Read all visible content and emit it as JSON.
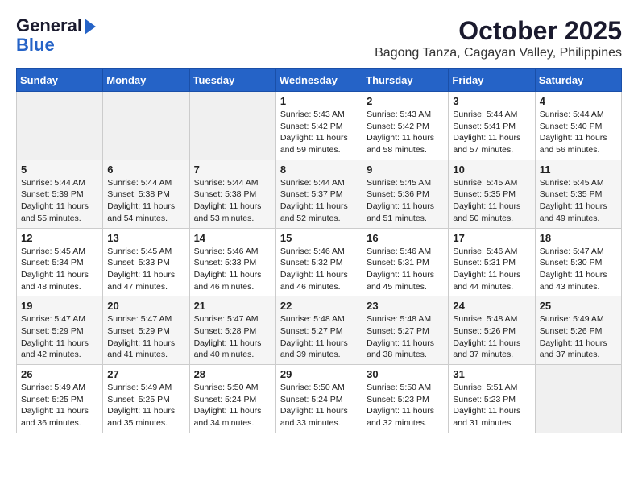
{
  "logo": {
    "line1": "General",
    "line2": "Blue"
  },
  "title": "October 2025",
  "subtitle": "Bagong Tanza, Cagayan Valley, Philippines",
  "days_of_week": [
    "Sunday",
    "Monday",
    "Tuesday",
    "Wednesday",
    "Thursday",
    "Friday",
    "Saturday"
  ],
  "weeks": [
    [
      {
        "day": "",
        "sunrise": "",
        "sunset": "",
        "daylight": ""
      },
      {
        "day": "",
        "sunrise": "",
        "sunset": "",
        "daylight": ""
      },
      {
        "day": "",
        "sunrise": "",
        "sunset": "",
        "daylight": ""
      },
      {
        "day": "1",
        "sunrise": "Sunrise: 5:43 AM",
        "sunset": "Sunset: 5:42 PM",
        "daylight": "Daylight: 11 hours and 59 minutes."
      },
      {
        "day": "2",
        "sunrise": "Sunrise: 5:43 AM",
        "sunset": "Sunset: 5:42 PM",
        "daylight": "Daylight: 11 hours and 58 minutes."
      },
      {
        "day": "3",
        "sunrise": "Sunrise: 5:44 AM",
        "sunset": "Sunset: 5:41 PM",
        "daylight": "Daylight: 11 hours and 57 minutes."
      },
      {
        "day": "4",
        "sunrise": "Sunrise: 5:44 AM",
        "sunset": "Sunset: 5:40 PM",
        "daylight": "Daylight: 11 hours and 56 minutes."
      }
    ],
    [
      {
        "day": "5",
        "sunrise": "Sunrise: 5:44 AM",
        "sunset": "Sunset: 5:39 PM",
        "daylight": "Daylight: 11 hours and 55 minutes."
      },
      {
        "day": "6",
        "sunrise": "Sunrise: 5:44 AM",
        "sunset": "Sunset: 5:38 PM",
        "daylight": "Daylight: 11 hours and 54 minutes."
      },
      {
        "day": "7",
        "sunrise": "Sunrise: 5:44 AM",
        "sunset": "Sunset: 5:38 PM",
        "daylight": "Daylight: 11 hours and 53 minutes."
      },
      {
        "day": "8",
        "sunrise": "Sunrise: 5:44 AM",
        "sunset": "Sunset: 5:37 PM",
        "daylight": "Daylight: 11 hours and 52 minutes."
      },
      {
        "day": "9",
        "sunrise": "Sunrise: 5:45 AM",
        "sunset": "Sunset: 5:36 PM",
        "daylight": "Daylight: 11 hours and 51 minutes."
      },
      {
        "day": "10",
        "sunrise": "Sunrise: 5:45 AM",
        "sunset": "Sunset: 5:35 PM",
        "daylight": "Daylight: 11 hours and 50 minutes."
      },
      {
        "day": "11",
        "sunrise": "Sunrise: 5:45 AM",
        "sunset": "Sunset: 5:35 PM",
        "daylight": "Daylight: 11 hours and 49 minutes."
      }
    ],
    [
      {
        "day": "12",
        "sunrise": "Sunrise: 5:45 AM",
        "sunset": "Sunset: 5:34 PM",
        "daylight": "Daylight: 11 hours and 48 minutes."
      },
      {
        "day": "13",
        "sunrise": "Sunrise: 5:45 AM",
        "sunset": "Sunset: 5:33 PM",
        "daylight": "Daylight: 11 hours and 47 minutes."
      },
      {
        "day": "14",
        "sunrise": "Sunrise: 5:46 AM",
        "sunset": "Sunset: 5:33 PM",
        "daylight": "Daylight: 11 hours and 46 minutes."
      },
      {
        "day": "15",
        "sunrise": "Sunrise: 5:46 AM",
        "sunset": "Sunset: 5:32 PM",
        "daylight": "Daylight: 11 hours and 46 minutes."
      },
      {
        "day": "16",
        "sunrise": "Sunrise: 5:46 AM",
        "sunset": "Sunset: 5:31 PM",
        "daylight": "Daylight: 11 hours and 45 minutes."
      },
      {
        "day": "17",
        "sunrise": "Sunrise: 5:46 AM",
        "sunset": "Sunset: 5:31 PM",
        "daylight": "Daylight: 11 hours and 44 minutes."
      },
      {
        "day": "18",
        "sunrise": "Sunrise: 5:47 AM",
        "sunset": "Sunset: 5:30 PM",
        "daylight": "Daylight: 11 hours and 43 minutes."
      }
    ],
    [
      {
        "day": "19",
        "sunrise": "Sunrise: 5:47 AM",
        "sunset": "Sunset: 5:29 PM",
        "daylight": "Daylight: 11 hours and 42 minutes."
      },
      {
        "day": "20",
        "sunrise": "Sunrise: 5:47 AM",
        "sunset": "Sunset: 5:29 PM",
        "daylight": "Daylight: 11 hours and 41 minutes."
      },
      {
        "day": "21",
        "sunrise": "Sunrise: 5:47 AM",
        "sunset": "Sunset: 5:28 PM",
        "daylight": "Daylight: 11 hours and 40 minutes."
      },
      {
        "day": "22",
        "sunrise": "Sunrise: 5:48 AM",
        "sunset": "Sunset: 5:27 PM",
        "daylight": "Daylight: 11 hours and 39 minutes."
      },
      {
        "day": "23",
        "sunrise": "Sunrise: 5:48 AM",
        "sunset": "Sunset: 5:27 PM",
        "daylight": "Daylight: 11 hours and 38 minutes."
      },
      {
        "day": "24",
        "sunrise": "Sunrise: 5:48 AM",
        "sunset": "Sunset: 5:26 PM",
        "daylight": "Daylight: 11 hours and 37 minutes."
      },
      {
        "day": "25",
        "sunrise": "Sunrise: 5:49 AM",
        "sunset": "Sunset: 5:26 PM",
        "daylight": "Daylight: 11 hours and 37 minutes."
      }
    ],
    [
      {
        "day": "26",
        "sunrise": "Sunrise: 5:49 AM",
        "sunset": "Sunset: 5:25 PM",
        "daylight": "Daylight: 11 hours and 36 minutes."
      },
      {
        "day": "27",
        "sunrise": "Sunrise: 5:49 AM",
        "sunset": "Sunset: 5:25 PM",
        "daylight": "Daylight: 11 hours and 35 minutes."
      },
      {
        "day": "28",
        "sunrise": "Sunrise: 5:50 AM",
        "sunset": "Sunset: 5:24 PM",
        "daylight": "Daylight: 11 hours and 34 minutes."
      },
      {
        "day": "29",
        "sunrise": "Sunrise: 5:50 AM",
        "sunset": "Sunset: 5:24 PM",
        "daylight": "Daylight: 11 hours and 33 minutes."
      },
      {
        "day": "30",
        "sunrise": "Sunrise: 5:50 AM",
        "sunset": "Sunset: 5:23 PM",
        "daylight": "Daylight: 11 hours and 32 minutes."
      },
      {
        "day": "31",
        "sunrise": "Sunrise: 5:51 AM",
        "sunset": "Sunset: 5:23 PM",
        "daylight": "Daylight: 11 hours and 31 minutes."
      },
      {
        "day": "",
        "sunrise": "",
        "sunset": "",
        "daylight": ""
      }
    ]
  ]
}
